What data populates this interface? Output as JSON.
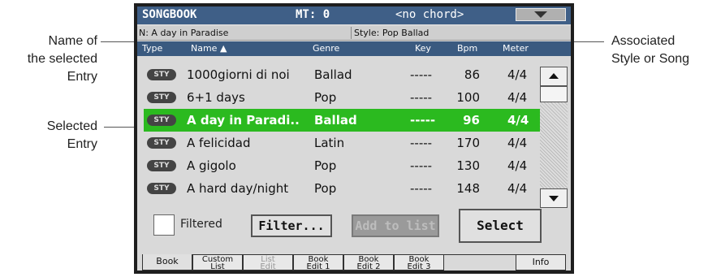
{
  "annotations": {
    "name_of_selected": "Name of\nthe selected\nEntry",
    "selected_entry": "Selected\nEntry",
    "associated": "Associated\nStyle or Song"
  },
  "header": {
    "title": "SONGBOOK",
    "mt": "MT: 0",
    "chord": "<no chord>",
    "menu_icon": "triangle-down-icon"
  },
  "entry": {
    "name": "N: A day in Paradise",
    "style": "Style: Pop Ballad"
  },
  "columns": {
    "type": "Type",
    "name": "Name ▲",
    "genre": "Genre",
    "key": "Key",
    "bpm": "Bpm",
    "meter": "Meter"
  },
  "rows": [
    {
      "type": "STY",
      "name": "1000giorni di noi",
      "genre": "Ballad",
      "key": "-----",
      "bpm": "86",
      "meter": "4/4"
    },
    {
      "type": "STY",
      "name": "6+1 days",
      "genre": "Pop",
      "key": "-----",
      "bpm": "100",
      "meter": "4/4"
    },
    {
      "type": "STY",
      "name": "A day in Paradi..",
      "genre": "Ballad",
      "key": "-----",
      "bpm": "96",
      "meter": "4/4"
    },
    {
      "type": "STY",
      "name": "A felicidad",
      "genre": "Latin",
      "key": "-----",
      "bpm": "170",
      "meter": "4/4"
    },
    {
      "type": "STY",
      "name": "A gigolo",
      "genre": "Pop",
      "key": "-----",
      "bpm": "130",
      "meter": "4/4"
    },
    {
      "type": "STY",
      "name": "A hard day/night",
      "genre": "Pop",
      "key": "-----",
      "bpm": "148",
      "meter": "4/4"
    }
  ],
  "selected_row": 3,
  "controls": {
    "filtered": "Filtered",
    "filter": "Filter...",
    "add_to_list": "Add to list",
    "select": "Select"
  },
  "tabs": {
    "book": "Book",
    "custom_list": "Custom\nList",
    "list_edit": "List\nEdit",
    "book_edit_1": "Book\nEdit 1",
    "book_edit_2": "Book\nEdit 2",
    "book_edit_3": "Book\nEdit 3",
    "info": "Info"
  },
  "colors": {
    "title_bar": "#3f5f87",
    "selection": "#2bba1f"
  }
}
